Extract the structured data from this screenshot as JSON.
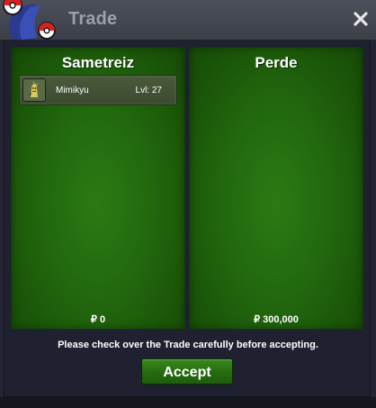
{
  "window": {
    "title": "Trade",
    "close_icon": "close-icon"
  },
  "colors": {
    "panel_green": "#236a0f",
    "accept_green": "#2a7a15",
    "window_bg": "#222433",
    "titlebar": "#454852"
  },
  "left_panel": {
    "trainer_name": "Sametreiz",
    "items": [
      {
        "name": "Mimikyu",
        "level": "Lvl: 27",
        "icon": "mimikyu-sprite-icon"
      }
    ],
    "money": "₽ 0"
  },
  "right_panel": {
    "trainer_name": "Perde",
    "items": [],
    "money": "₽ 300,000"
  },
  "notice": "Please check over the Trade carefully before accepting.",
  "accept_label": "Accept"
}
